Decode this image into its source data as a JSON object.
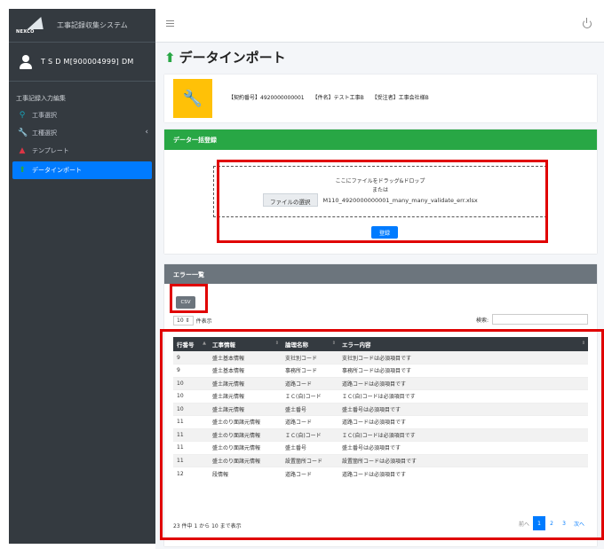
{
  "app": {
    "logo_text": "NEXCO",
    "brand_title": "工事記録収集システム",
    "user_name": "T S D M[900004999] DM"
  },
  "sidebar": {
    "section_header": "工事記録入力編集",
    "items": [
      {
        "label": "工事選択",
        "icon": "search-icon"
      },
      {
        "label": "工種選択",
        "icon": "wrench-icon"
      },
      {
        "label": "テンプレート",
        "icon": "template-icon"
      },
      {
        "label": "データインポート",
        "icon": "upload-icon",
        "active": true
      }
    ]
  },
  "page": {
    "title": "データインポート",
    "contract_no": "【契約番号】4920000000001",
    "case_name": "【件名】テスト工事B",
    "contractor": "【受注者】工事会社様B"
  },
  "upload": {
    "header": "データ一括登録",
    "drop_line1": "ここにファイルをドラッグ&ドロップ",
    "drop_line2": "または",
    "file_button": "ファイルの選択",
    "file_name": "M110_4920000000001_many_many_validate_err.xlsx",
    "register_button": "登録"
  },
  "errors": {
    "header": "エラー一覧",
    "csv_button": "CSV",
    "length_value": "10",
    "length_suffix": "件表示",
    "search_label": "検索:",
    "columns": [
      "行番号",
      "工事情報",
      "論理名称",
      "エラー内容"
    ],
    "rows": [
      [
        "9",
        "盛土基本情報",
        "支社別コード",
        "支社別コードは必須項目です"
      ],
      [
        "9",
        "盛土基本情報",
        "事務所コード",
        "事務所コードは必須項目です"
      ],
      [
        "10",
        "盛土諸元情報",
        "道路コード",
        "道路コードは必須項目です"
      ],
      [
        "10",
        "盛土諸元情報",
        "ＩＣ(自)コード",
        "ＩＣ(自)コードは必須項目です"
      ],
      [
        "10",
        "盛土諸元情報",
        "盛土番号",
        "盛土番号は必須項目です"
      ],
      [
        "11",
        "盛土のり面諸元情報",
        "道路コード",
        "道路コードは必須項目です"
      ],
      [
        "11",
        "盛土のり面諸元情報",
        "ＩＣ(自)コード",
        "ＩＣ(自)コードは必須項目です"
      ],
      [
        "11",
        "盛土のり面諸元情報",
        "盛土番号",
        "盛土番号は必須項目です"
      ],
      [
        "11",
        "盛土のり面諸元情報",
        "設置箇所コード",
        "設置箇所コードは必須項目です"
      ],
      [
        "12",
        "段情報",
        "道路コード",
        "道路コードは必須項目です"
      ]
    ],
    "info": "23 件中 1 から 10 まで表示",
    "pager": {
      "prev": "前へ",
      "pages": [
        "1",
        "2",
        "3"
      ],
      "next": "次へ",
      "current": "1"
    }
  },
  "colors": {
    "sidebar_bg": "#343a40",
    "accent_blue": "#007bff",
    "upload_header_green": "#28a745",
    "error_header_gray": "#6c757d",
    "info_tile_yellow": "#ffc107",
    "highlight_red": "#e00000"
  }
}
